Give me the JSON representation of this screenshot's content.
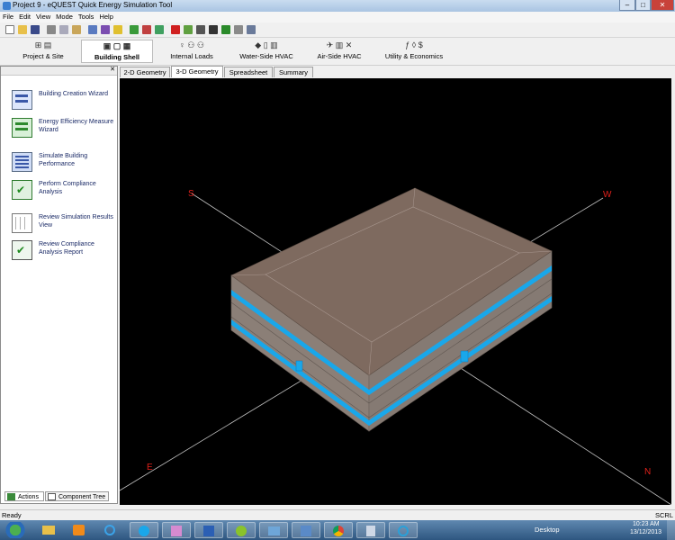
{
  "window": {
    "title": "Project 9 - eQUEST Quick Energy Simulation Tool",
    "minimize": "–",
    "maximize": "□",
    "close": "✕"
  },
  "menu": [
    "File",
    "Edit",
    "View",
    "Mode",
    "Tools",
    "Help"
  ],
  "modules": [
    {
      "label": "Project & Site",
      "icon": "⊞ ▤"
    },
    {
      "label": "Building Shell",
      "icon": "▣ ▢ ▦"
    },
    {
      "label": "Internal Loads",
      "icon": "♀ ⚇ ⚇"
    },
    {
      "label": "Water-Side HVAC",
      "icon": "◆ ▯ ▥"
    },
    {
      "label": "Air-Side HVAC",
      "icon": "✈ ▥ ✕"
    },
    {
      "label": "Utility & Economics",
      "icon": "ƒ ◊ $"
    }
  ],
  "actions": [
    {
      "label": "Building Creation Wizard"
    },
    {
      "label": "Energy Efficiency Measure Wizard"
    },
    {
      "label": "Simulate Building Performance"
    },
    {
      "label": "Perform Compliance Analysis"
    },
    {
      "label": "Review Simulation Results View"
    },
    {
      "label": "Review Compliance Analysis Report"
    }
  ],
  "left_tabs": {
    "actions": "Actions",
    "component_tree": "Component Tree"
  },
  "view_tabs": [
    "2-D Geometry",
    "3-D Geometry",
    "Spreadsheet",
    "Summary"
  ],
  "compass": {
    "s": "S",
    "w": "W",
    "e": "E",
    "n": "N"
  },
  "status": {
    "left": "Ready",
    "right": "SCRL"
  },
  "taskbar": {
    "desktop": "Desktop",
    "time": "10:23 AM",
    "date": "13/12/2013"
  },
  "colors": {
    "roof": "#7e6a5f",
    "wall": "#8b7f77",
    "glazing": "#19a7ea",
    "compass": "#c0c0c0",
    "compass_label": "#e0201a"
  }
}
